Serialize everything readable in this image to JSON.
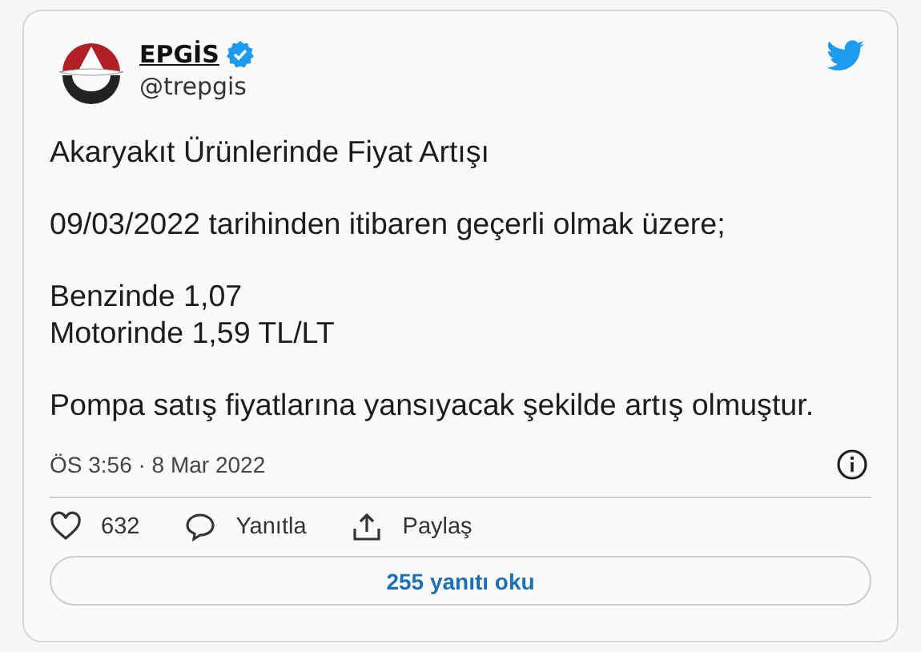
{
  "author": {
    "name": "EPGİS",
    "verified": true,
    "handle": "@trepgis"
  },
  "paragraphs": [
    [
      "Akaryakıt Ürünlerinde Fiyat Artışı"
    ],
    [
      "09/03/2022 tarihinden itibaren geçerli olmak üzere;"
    ],
    [
      "Benzinde 1,07",
      "Motorinde 1,59 TL/LT"
    ],
    [
      "Pompa satış fiyatlarına yansıyacak şekilde artış olmuştur."
    ]
  ],
  "timestamp": "ÖS 3:56 · 8 Mar 2022",
  "actions": [
    {
      "kind": "like",
      "label": "632"
    },
    {
      "kind": "reply",
      "label": "Yanıtla"
    },
    {
      "kind": "share",
      "label": "Paylaş"
    }
  ],
  "read_replies": "255 yanıtı oku"
}
